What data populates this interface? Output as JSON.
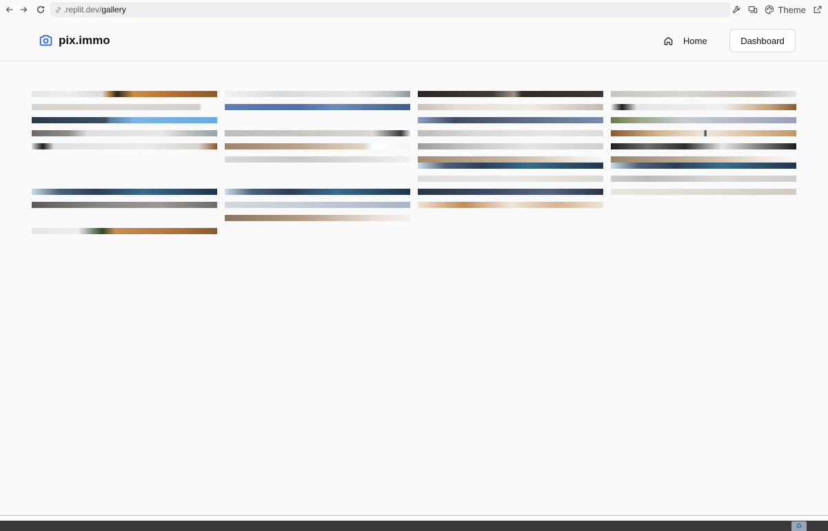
{
  "browser": {
    "url_host": ".replit.dev/",
    "url_path": "gallery",
    "theme_label": "Theme"
  },
  "header": {
    "brand": "pix.immo",
    "nav_home": "Home",
    "nav_dashboard": "Dashboard"
  },
  "icons": {
    "back": "arrow-left-icon",
    "forward": "arrow-right-icon",
    "reload": "reload-icon",
    "link": "link-icon",
    "tools": "wrench-icon",
    "devices": "devices-icon",
    "theme": "palette-icon",
    "popout": "external-link-icon",
    "brand": "camera-icon",
    "home": "home-icon"
  },
  "colors": {
    "accent": "#2563eb",
    "page_bg": "#fafafa",
    "border": "#e4e4e7"
  }
}
